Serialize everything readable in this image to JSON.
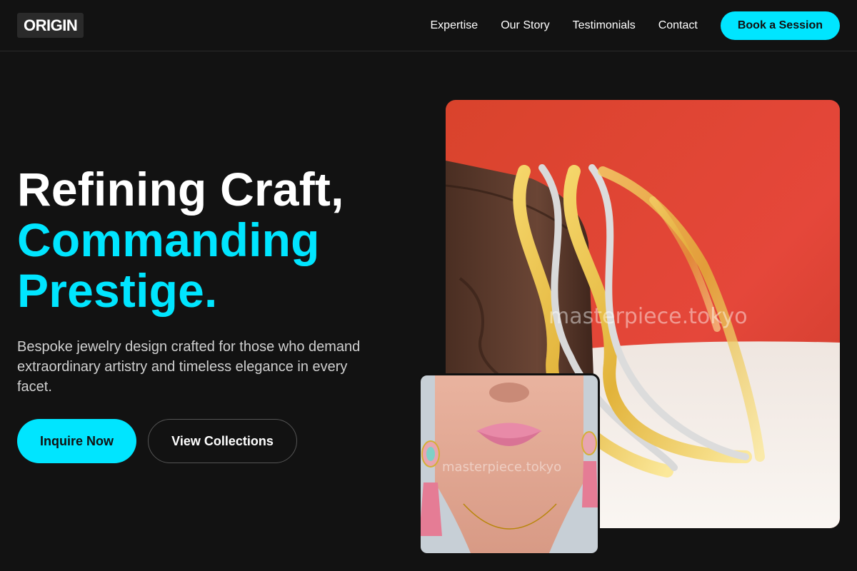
{
  "nav": {
    "logo": "ORIGIN",
    "links": [
      "Expertise",
      "Our Story",
      "Testimonials",
      "Contact"
    ],
    "cta": "Book a Session"
  },
  "hero": {
    "title_line1": "Refining Craft,",
    "title_line2": "Commanding",
    "title_line3": "Prestige.",
    "description": "Bespoke jewelry design crafted for those who demand extraordinary artistry and timeless elegance in every facet.",
    "primary_button": "Inquire Now",
    "secondary_button": "View Collections"
  },
  "images": {
    "main_watermark": "masterpiece.tokyo",
    "small_watermark": "masterpiece.tokyo"
  },
  "colors": {
    "accent": "#00e5ff",
    "background": "#121212"
  }
}
